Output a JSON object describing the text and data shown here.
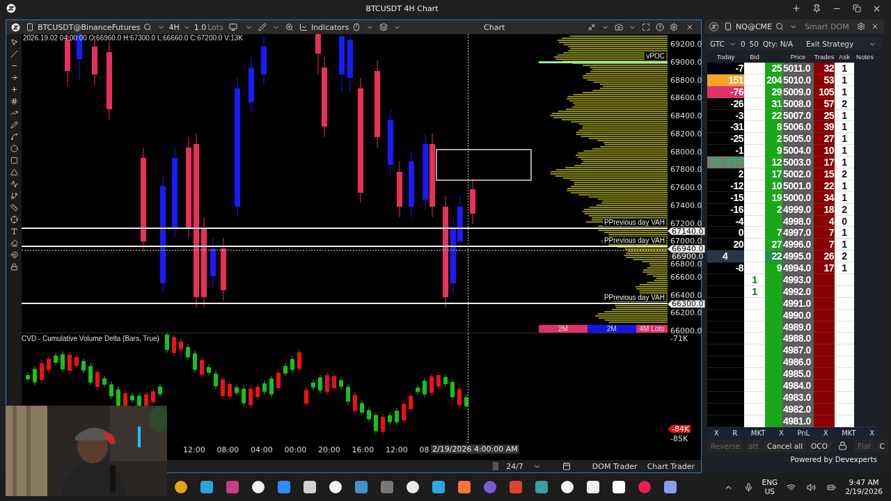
{
  "window": {
    "title": "BTCUSDT 4H Chart"
  },
  "chart": {
    "symbol": "BTCUSDT@BinanceFutures",
    "timeframe": "4H",
    "quantity": "1.0",
    "quantity_unit": "Lots",
    "indicators_button": "Indicators",
    "panel_title": "Chart",
    "ohlc": "2026.19.02 04:00:00 O:66960.0 H:67300.0 L:66660.0 C:67200.0 V:13K",
    "price_axis": [
      "69200.0",
      "69000.0",
      "68800.0",
      "68600.0",
      "68400.0",
      "68200.0",
      "68000.0",
      "67800.0",
      "67600.0",
      "67400.0",
      "67200.0",
      "67000.0",
      "66800.0",
      "66600.0",
      "66400.0",
      "66200.0",
      "66000.0"
    ],
    "levels": [
      {
        "label": "PPrevious day VAH",
        "tag": "67140.0"
      },
      {
        "label": "PPrevious day VAH",
        "tag": "66940.0"
      },
      {
        "label": "PPrevious day VAH",
        "tag": "66300.0"
      }
    ],
    "crosshair_price": "66900.0",
    "poc_label": "vPOC",
    "volume_bar": [
      {
        "label": "2M",
        "color": "#e0306a"
      },
      {
        "label": "2M",
        "color": "#1414e6"
      },
      {
        "label": "4M Lots",
        "color": "#e0306a"
      }
    ],
    "cvd": {
      "title": "CVD - Cumulative Volume Delta (Bars, True)",
      "axis_top": "-71K",
      "tag": "-84K",
      "axis_bottom": "-85K"
    },
    "time_axis": [
      "12:00",
      "08:00",
      "04:00",
      "00:00",
      "20:00",
      "16:00",
      "12:00",
      "08"
    ],
    "crosshair_time": "2/19/2026 4:00:00 AM",
    "session": "24/7",
    "buttons": [
      "DOM Trader",
      "Chart Trader"
    ]
  },
  "dom": {
    "symbol": "NQ@CME",
    "mode": "Smart DOM",
    "tif": "GTC",
    "qty_a": "0",
    "qty_b": "50",
    "qty_label": "Qty: N/A",
    "strategy": "Exit Strategy",
    "columns": [
      "Today",
      "Bid",
      "Price",
      "Trades",
      "Ask",
      "Notes"
    ],
    "rows": [
      {
        "today": "-7",
        "bid": "",
        "size": "25",
        "price": "5011.0",
        "trades": "32",
        "ask": "1",
        "selected": false
      },
      {
        "today": "151",
        "color": "#f5a623",
        "bid": "",
        "size": "204",
        "price": "5010.0",
        "trades": "53",
        "ask": "1",
        "selected": false
      },
      {
        "today": "-76",
        "color": "#e0306a",
        "bid": "",
        "size": "29",
        "price": "5009.0",
        "trades": "105",
        "ask": "1",
        "selected": false
      },
      {
        "today": "-26",
        "bid": "",
        "size": "31",
        "price": "5008.0",
        "trades": "57",
        "ask": "2",
        "selected": false
      },
      {
        "today": "-3",
        "bid": "",
        "size": "22",
        "price": "5007.0",
        "trades": "25",
        "ask": "1",
        "selected": false
      },
      {
        "today": "-31",
        "bid": "",
        "size": "8",
        "price": "5006.0",
        "trades": "39",
        "ask": "1",
        "selected": false
      },
      {
        "today": "-25",
        "bid": "",
        "size": "2",
        "price": "5005.0",
        "trades": "27",
        "ask": "1",
        "selected": false
      },
      {
        "today": "-1",
        "bid": "",
        "size": "9",
        "price": "5004.0",
        "trades": "10",
        "ask": "1",
        "selected": false
      },
      {
        "today": "UY STP",
        "color": "#7a7a7a",
        "bid": "",
        "size": "12",
        "price": "5003.0",
        "trades": "17",
        "ask": "1",
        "selected": false
      },
      {
        "today": "2",
        "bid": "",
        "size": "17",
        "price": "5002.0",
        "trades": "15",
        "ask": "2",
        "selected": false
      },
      {
        "today": "-12",
        "bid": "",
        "size": "10",
        "price": "5001.0",
        "trades": "22",
        "ask": "1",
        "selected": false
      },
      {
        "today": "-15",
        "bid": "",
        "size": "19",
        "price": "5000.0",
        "trades": "34",
        "ask": "1",
        "selected": false
      },
      {
        "today": "-16",
        "bid": "",
        "size": "2",
        "price": "4999.0",
        "trades": "18",
        "ask": "2",
        "selected": false
      },
      {
        "today": "-4",
        "bid": "",
        "size": "",
        "price": "4998.0",
        "trades": "4",
        "ask": "0",
        "selected": false
      },
      {
        "today": "0",
        "bid": "",
        "size": "7",
        "price": "4997.0",
        "trades": "7",
        "ask": "1",
        "selected": false
      },
      {
        "today": "20",
        "bid": "",
        "size": "27",
        "price": "4996.0",
        "trades": "7",
        "ask": "1",
        "selected": false
      },
      {
        "today": "4",
        "bid": "",
        "size": "22",
        "price": "4995.0",
        "trades": "26",
        "ask": "2",
        "selected": true
      },
      {
        "today": "-8",
        "bid": "",
        "size": "9",
        "price": "4994.0",
        "trades": "17",
        "ask": "1",
        "selected": false
      },
      {
        "today": "",
        "bid": "1",
        "size": "",
        "price": "4993.0",
        "trades": "",
        "ask": "",
        "selected": false
      },
      {
        "today": "",
        "bid": "1",
        "size": "",
        "price": "4992.0",
        "trades": "",
        "ask": "",
        "selected": false
      },
      {
        "today": "",
        "bid": "",
        "size": "",
        "price": "4991.0",
        "trades": "",
        "ask": "",
        "selected": false
      },
      {
        "today": "",
        "bid": "",
        "size": "",
        "price": "4990.0",
        "trades": "",
        "ask": "",
        "selected": false
      },
      {
        "today": "",
        "bid": "",
        "size": "",
        "price": "4989.0",
        "trades": "",
        "ask": "",
        "selected": false
      },
      {
        "today": "",
        "bid": "",
        "size": "",
        "price": "4988.0",
        "trades": "",
        "ask": "",
        "selected": false
      },
      {
        "today": "",
        "bid": "",
        "size": "",
        "price": "4987.0",
        "trades": "",
        "ask": "",
        "selected": false
      },
      {
        "today": "",
        "bid": "",
        "size": "",
        "price": "4986.0",
        "trades": "",
        "ask": "",
        "selected": false
      },
      {
        "today": "",
        "bid": "",
        "size": "",
        "price": "4985.0",
        "trades": "",
        "ask": "",
        "selected": false
      },
      {
        "today": "",
        "bid": "",
        "size": "",
        "price": "4984.0",
        "trades": "",
        "ask": "",
        "selected": false
      },
      {
        "today": "",
        "bid": "",
        "size": "",
        "price": "4983.0",
        "trades": "",
        "ask": "",
        "selected": false
      },
      {
        "today": "",
        "bid": "",
        "size": "",
        "price": "4982.0",
        "trades": "",
        "ask": "",
        "selected": false
      },
      {
        "today": "",
        "bid": "",
        "size": "",
        "price": "4981.0",
        "trades": "",
        "ask": "",
        "selected": false
      }
    ],
    "footer_actions": [
      "X",
      "R",
      "MKT",
      "X",
      "PnL",
      "X",
      "MKT",
      "X"
    ],
    "buttons": [
      {
        "label": "Reverse",
        "disabled": true
      },
      {
        "label": "att",
        "disabled": true
      },
      {
        "label": "Cancel all",
        "disabled": false
      },
      {
        "label": "OCO",
        "disabled": false
      },
      {
        "label": "Flat",
        "disabled": true
      },
      {
        "label": "C",
        "disabled": false
      }
    ],
    "powered_by": "Powered by Devexperts"
  },
  "taskbar": {
    "language": "ENG",
    "region": "US",
    "time": "9:47 AM",
    "date": "2/19/2026"
  }
}
